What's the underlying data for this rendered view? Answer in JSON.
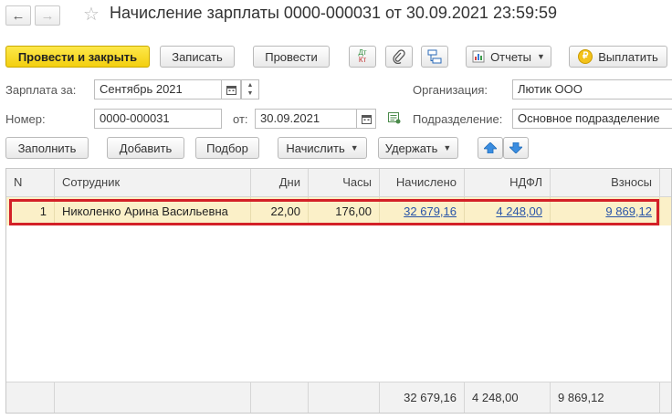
{
  "header": {
    "title": "Начисление зарплаты 0000-000031 от 30.09.2021 23:59:59",
    "back_glyph": "←",
    "forward_glyph": "→",
    "star_glyph": "☆"
  },
  "toolbar": {
    "post_close": "Провести и закрыть",
    "save": "Записать",
    "post": "Провести",
    "dtkt_top": "Дт",
    "dtkt_bottom": "Кт",
    "reports": "Отчеты",
    "pay": "Выплатить"
  },
  "form": {
    "salary_for_label": "Зарплата за:",
    "salary_for_value": "Сентябрь 2021",
    "number_label": "Номер:",
    "number_value": "0000-000031",
    "date_label": "от:",
    "date_value": "30.09.2021",
    "org_label": "Организация:",
    "org_value": "Лютик ООО",
    "dept_label": "Подразделение:",
    "dept_value": "Основное подразделение"
  },
  "table_toolbar": {
    "fill": "Заполнить",
    "add": "Добавить",
    "pick": "Подбор",
    "accrue": "Начислить",
    "withhold": "Удержать"
  },
  "table": {
    "columns": [
      "N",
      "Сотрудник",
      "Дни",
      "Часы",
      "Начислено",
      "НДФЛ",
      "Взносы"
    ],
    "rows": [
      {
        "n": "1",
        "employee": "Николенко Арина Васильевна",
        "days": "22,00",
        "hours": "176,00",
        "accrued": "32 679,16",
        "ndfl": "4 248,00",
        "contrib": "9 869,12"
      }
    ],
    "totals": {
      "accrued": "32 679,16",
      "ndfl": "4 248,00",
      "contrib": "9 869,12"
    }
  },
  "colors": {
    "primary": "#f3cf10",
    "selection": "#d32027",
    "row_highlight": "#fbf0c8",
    "link": "#2a55a8"
  }
}
